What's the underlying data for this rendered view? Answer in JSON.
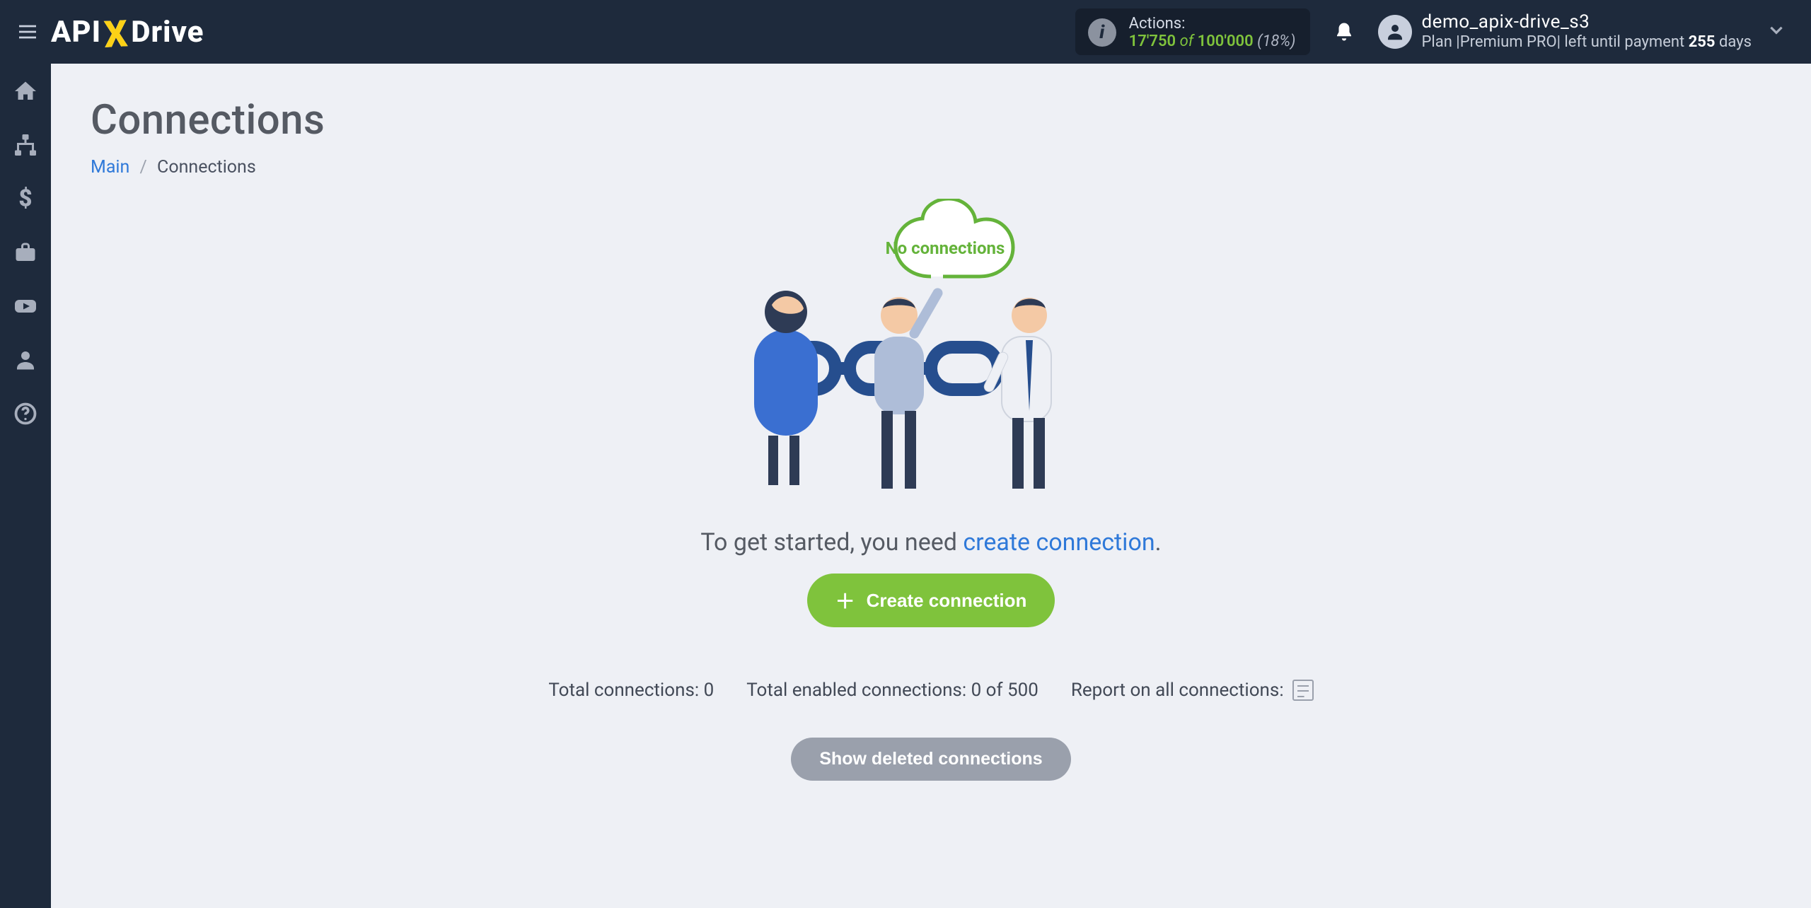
{
  "brand": {
    "name_pre": "API",
    "name_post": "Drive",
    "x": "X"
  },
  "actions": {
    "label": "Actions:",
    "used": "17'750",
    "of": "of",
    "limit": "100'000",
    "pct": "(18%)"
  },
  "account": {
    "name": "demo_apix-drive_s3",
    "plan_prefix": "Plan |",
    "plan_name": "Premium PRO",
    "plan_mid": "| left until payment ",
    "days": "255",
    "days_suffix": " days"
  },
  "sidebar": {
    "items": [
      {
        "icon": "home"
      },
      {
        "icon": "hierarchy"
      },
      {
        "icon": "dollar"
      },
      {
        "icon": "briefcase"
      },
      {
        "icon": "youtube"
      },
      {
        "icon": "user"
      },
      {
        "icon": "help"
      }
    ]
  },
  "page": {
    "title": "Connections",
    "breadcrumb": {
      "root": "Main",
      "sep": "/",
      "current": "Connections"
    }
  },
  "illustration": {
    "cloud_text": "No connections"
  },
  "empty": {
    "text_pre": "To get started, you need ",
    "link": "create connection",
    "text_post": "."
  },
  "buttons": {
    "create": "Create connection",
    "show_deleted": "Show deleted connections"
  },
  "stats": {
    "total_label": "Total connections: ",
    "total_value": "0",
    "enabled_label": "Total enabled connections: ",
    "enabled_value": "0 of 500",
    "report_label": "Report on all connections:"
  }
}
